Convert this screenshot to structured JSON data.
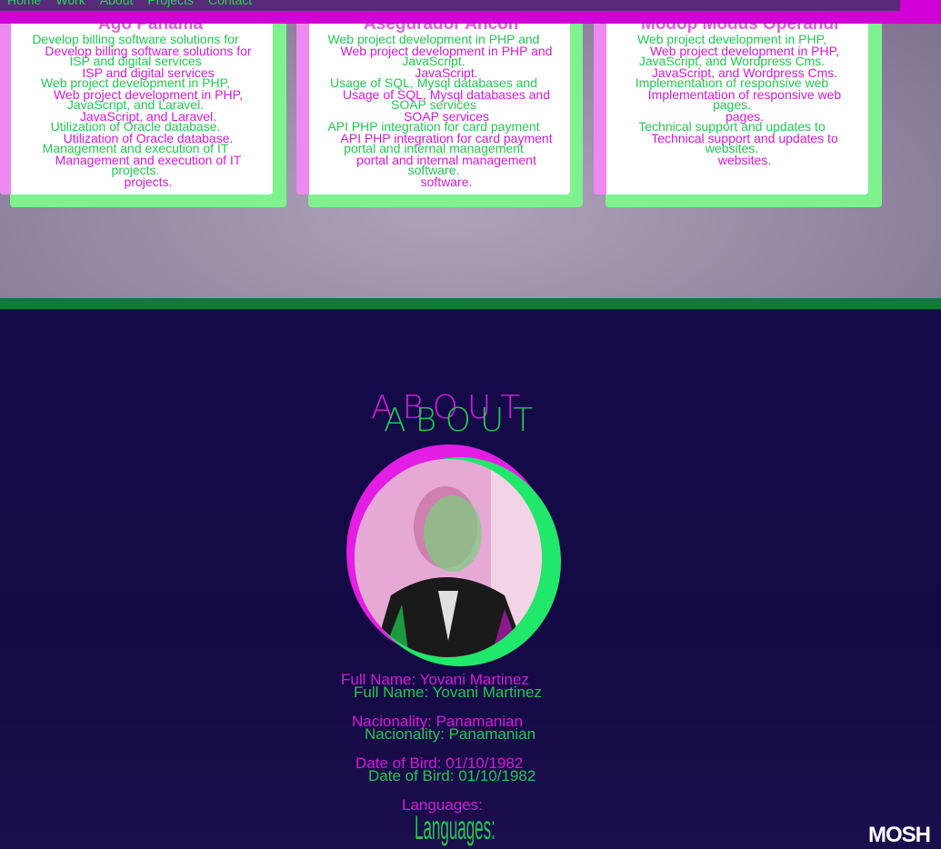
{
  "nav": {
    "items": [
      "Home",
      "Work",
      "About",
      "Projects",
      "Contact"
    ]
  },
  "work": {
    "cards": [
      {
        "title": "Ago Panama",
        "lines": [
          "Develop billing software solutions for",
          "ISP and digital services",
          "Web project development in PHP,",
          "JavaScript, and Laravel.",
          "Utilization of Oracle database.",
          "Management and execution of IT",
          "projects."
        ]
      },
      {
        "title": "Asegurador Ancon",
        "lines": [
          "Web project development in PHP and",
          "JavaScript.",
          "Usage of SQL, Mysql databases and",
          "SOAP services",
          "API PHP integration for card payment",
          "portal and internal management",
          "software."
        ]
      },
      {
        "title": "Modop Modus Operandi",
        "lines": [
          "Web project development in PHP,",
          "JavaScript, and Wordpress Cms.",
          "Implementation of responsive web",
          "pages.",
          "Technical support and updates to",
          "websites."
        ]
      }
    ]
  },
  "about": {
    "heading": "ABOUT",
    "full_name": "Full Name: Yovani Martinez",
    "nationality": "Nacionality: Panamanian",
    "birth_date": "Date of Bird: 01/10/1982",
    "languages_label": "Languages:"
  },
  "watermark": "MOSH",
  "colors": {
    "ghost_magenta": "#d31ad8",
    "ghost_green": "#23c850",
    "navbar": "#d100d6",
    "divider": "#0f7a3c",
    "background": "#150a45"
  }
}
